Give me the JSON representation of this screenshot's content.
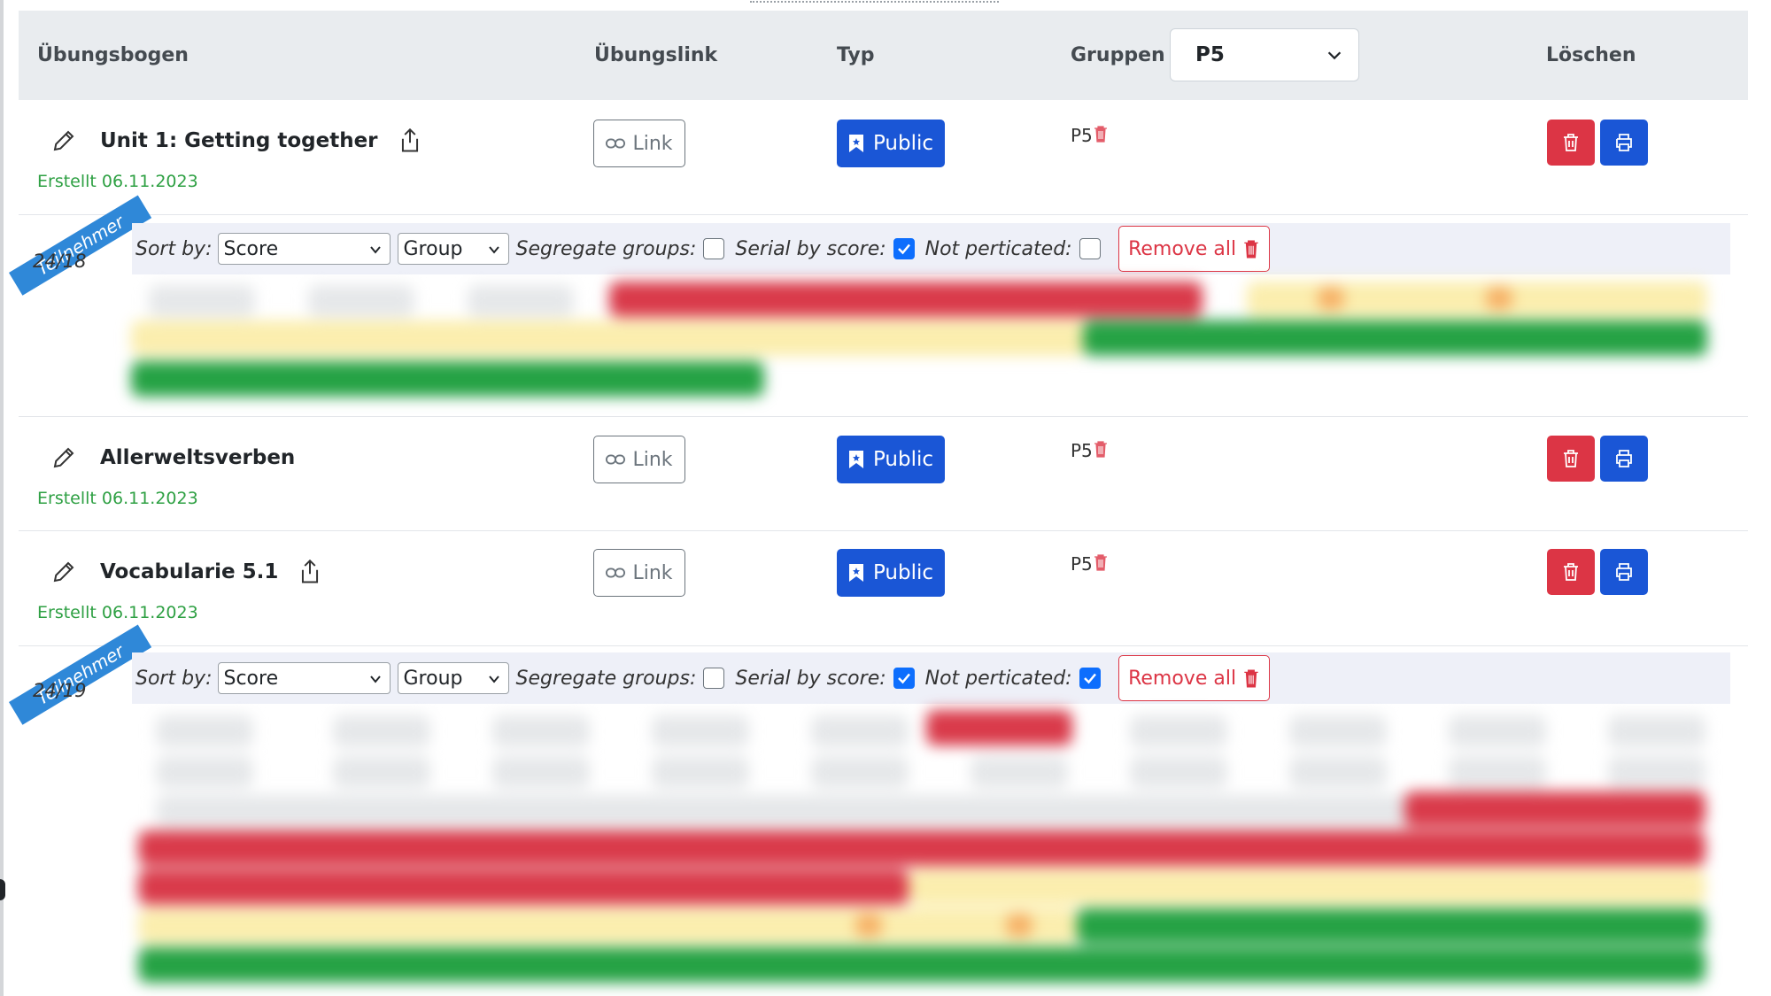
{
  "header": {
    "col_exercise": "Übungsbogen",
    "col_link": "Übungslink",
    "col_type": "Typ",
    "col_groups": "Gruppen",
    "group_filter_value": "P5",
    "col_delete": "Löschen"
  },
  "exercises": [
    {
      "title": "Unit 1: Getting together",
      "created": "Erstellt 06.11.2023",
      "link_label": "Link",
      "type_label": "Public",
      "group": "P5"
    },
    {
      "title": "Allerweltsverben",
      "created": "Erstellt 06.11.2023",
      "link_label": "Link",
      "type_label": "Public",
      "group": "P5"
    },
    {
      "title": "Vocabularie 5.1",
      "created": "Erstellt 06.11.2023",
      "link_label": "Link",
      "type_label": "Public",
      "group": "P5"
    }
  ],
  "panels": [
    {
      "ribbon": "Teilnehmer",
      "count": "24/18",
      "sort_label": "Sort by:",
      "sort_value": "Score",
      "group_value": "Group",
      "segregate_label": "Segregate groups:",
      "segregate_checked": false,
      "serial_label": "Serial by score:",
      "serial_checked": true,
      "notpart_label": "Not perticated:",
      "notpart_checked": false,
      "remove_label": "Remove all"
    },
    {
      "ribbon": "Teilnehmer",
      "count": "24/19",
      "sort_label": "Sort by:",
      "sort_value": "Score",
      "group_value": "Group",
      "segregate_label": "Segregate groups:",
      "segregate_checked": false,
      "serial_label": "Serial by score:",
      "serial_checked": true,
      "notpart_label": "Not perticated:",
      "notpart_checked": true,
      "remove_label": "Remove all"
    }
  ],
  "colors": {
    "primary": "#1a56d6",
    "danger": "#dc3545",
    "success": "#2ea043",
    "ribbon": "#2f88d8",
    "header_bg": "#e9ecef"
  }
}
